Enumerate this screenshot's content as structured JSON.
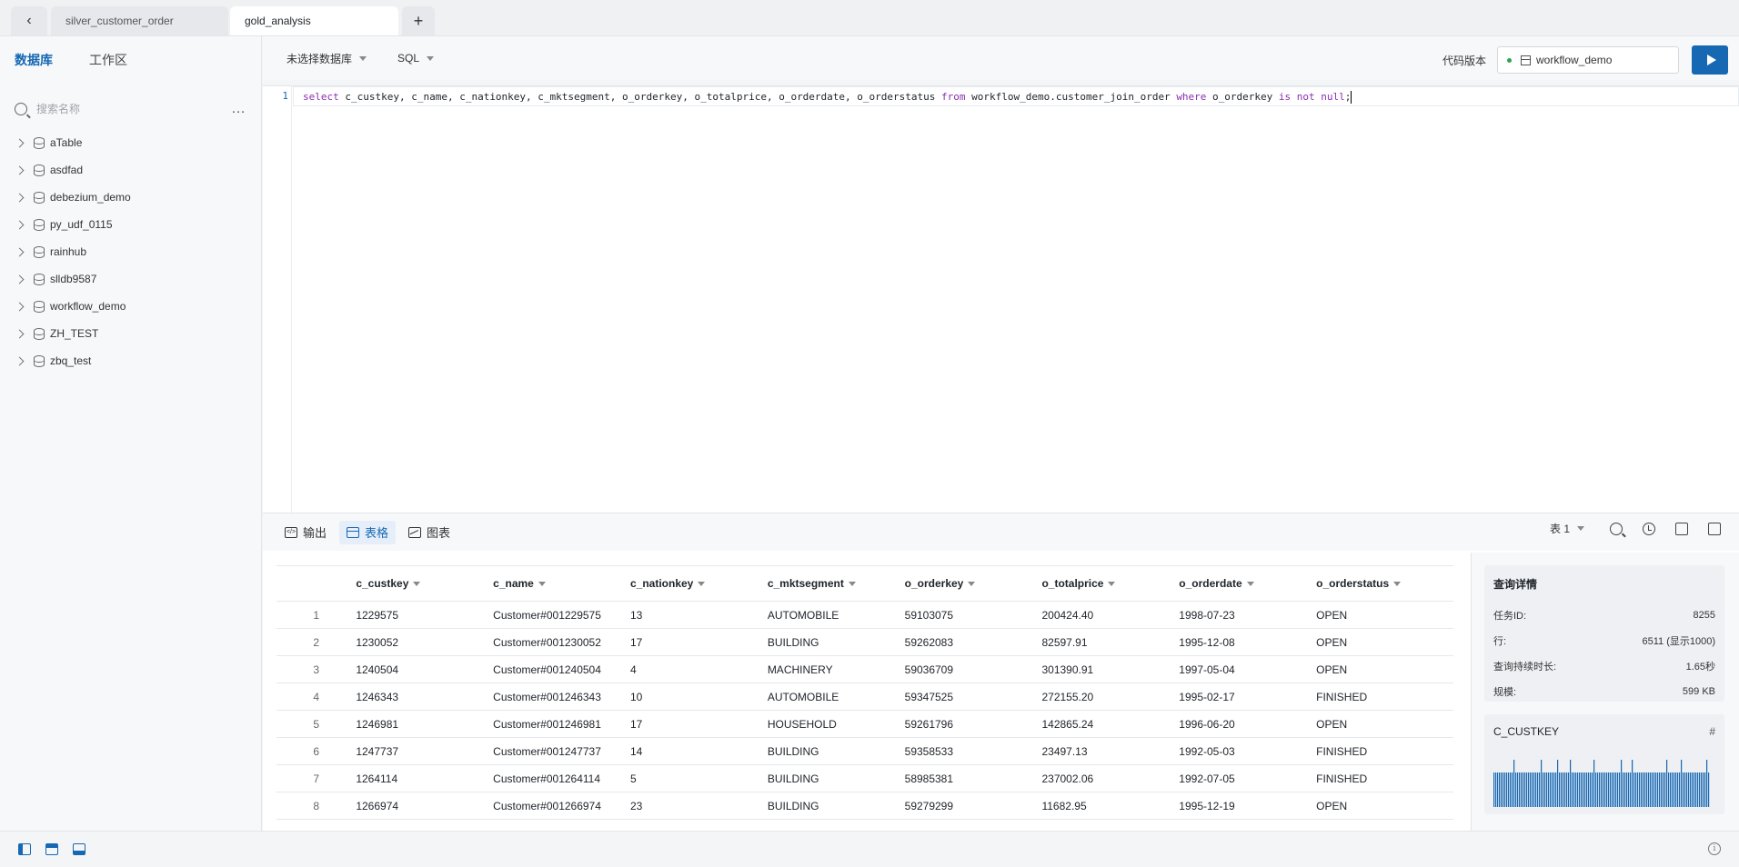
{
  "tabs": {
    "back_icon": "chevron-left-icon",
    "items": [
      {
        "label": "silver_customer_order",
        "active": false
      },
      {
        "label": "gold_analysis",
        "active": true
      }
    ],
    "add_icon": "plus-icon"
  },
  "sidebar": {
    "tabs": [
      "数据库",
      "工作区"
    ],
    "search_placeholder": "搜索名称",
    "more_icon": "more-icon",
    "databases": [
      "aTable",
      "asdfad",
      "debezium_demo",
      "py_udf_0115",
      "rainhub",
      "slldb9587",
      "workflow_demo",
      "ZH_TEST",
      "zbq_test"
    ]
  },
  "toolbar": {
    "database_select": "未选择数据库",
    "language_select": "SQL",
    "version_label": "代码版本",
    "version_value": "workflow_demo",
    "run_icon": "play-icon"
  },
  "editor": {
    "line_number": "1",
    "tokens": [
      {
        "t": "select",
        "kw": true
      },
      {
        "t": " c_custkey, c_name, c_nationkey, c_mktsegment, o_orderkey, o_totalprice, o_orderdate, o_orderstatus ",
        "kw": false
      },
      {
        "t": "from",
        "kw": true
      },
      {
        "t": " workflow_demo.customer_join_order ",
        "kw": false
      },
      {
        "t": "where",
        "kw": true
      },
      {
        "t": " o_orderkey ",
        "kw": false
      },
      {
        "t": "is not null",
        "kw": true
      },
      {
        "t": ";",
        "kw": false
      }
    ]
  },
  "result_tabs": {
    "output": "输出",
    "table": "表格",
    "chart": "图表",
    "table_select": "表 1"
  },
  "grid": {
    "columns": [
      "c_custkey",
      "c_name",
      "c_nationkey",
      "c_mktsegment",
      "o_orderkey",
      "o_totalprice",
      "o_orderdate",
      "o_orderstatus"
    ],
    "rows": [
      [
        "1",
        "1229575",
        "Customer#001229575",
        "13",
        "AUTOMOBILE",
        "59103075",
        "200424.40",
        "1998-07-23",
        "OPEN"
      ],
      [
        "2",
        "1230052",
        "Customer#001230052",
        "17",
        "BUILDING",
        "59262083",
        "82597.91",
        "1995-12-08",
        "OPEN"
      ],
      [
        "3",
        "1240504",
        "Customer#001240504",
        "4",
        "MACHINERY",
        "59036709",
        "301390.91",
        "1997-05-04",
        "OPEN"
      ],
      [
        "4",
        "1246343",
        "Customer#001246343",
        "10",
        "AUTOMOBILE",
        "59347525",
        "272155.20",
        "1995-02-17",
        "FINISHED"
      ],
      [
        "5",
        "1246981",
        "Customer#001246981",
        "17",
        "HOUSEHOLD",
        "59261796",
        "142865.24",
        "1996-06-20",
        "OPEN"
      ],
      [
        "6",
        "1247737",
        "Customer#001247737",
        "14",
        "BUILDING",
        "59358533",
        "23497.13",
        "1992-05-03",
        "FINISHED"
      ],
      [
        "7",
        "1264114",
        "Customer#001264114",
        "5",
        "BUILDING",
        "58985381",
        "237002.06",
        "1992-07-05",
        "FINISHED"
      ],
      [
        "8",
        "1266974",
        "Customer#001266974",
        "23",
        "BUILDING",
        "59279299",
        "11682.95",
        "1995-12-19",
        "OPEN"
      ]
    ]
  },
  "details": {
    "title": "查询详情",
    "items": [
      {
        "k": "任务ID:",
        "v": "8255"
      },
      {
        "k": "行:",
        "v": "6511 (显示1000)"
      },
      {
        "k": "查询持续时长:",
        "v": "1.65秒"
      },
      {
        "k": "规模:",
        "v": "599 KB"
      }
    ],
    "column_card_title": "C_CUSTKEY",
    "column_card_icon": "hash-icon"
  },
  "colors": {
    "accent": "#1668b3",
    "keyword": "#8a2fb0"
  }
}
